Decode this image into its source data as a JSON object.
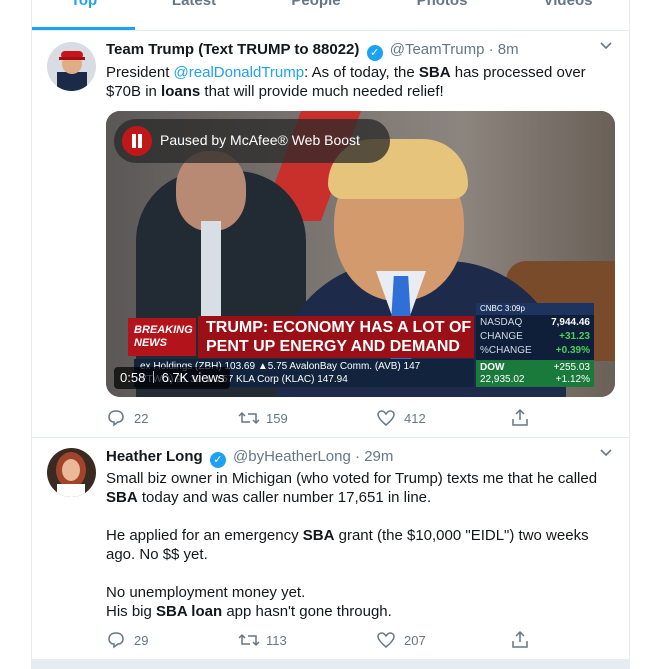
{
  "tabs": [
    {
      "label": "Top",
      "active": true
    },
    {
      "label": "Latest",
      "active": false
    },
    {
      "label": "People",
      "active": false
    },
    {
      "label": "Photos",
      "active": false
    },
    {
      "label": "Videos",
      "active": false
    }
  ],
  "tweets": [
    {
      "display_name": "Team Trump (Text TRUMP to 88022)",
      "handle": "@TeamTrump",
      "separator": "·",
      "time": "8m",
      "text_parts": {
        "p1": "President ",
        "mention": "@realDonaldTrump",
        "p2": ": As of today, the ",
        "b1": "SBA",
        "p3": " has processed over $70B in ",
        "b2": "loans",
        "p4": " that will provide much needed relief!"
      },
      "video": {
        "paused_label": "Paused by McAfee® Web Boost",
        "duration": "0:58",
        "views": "6.7K views",
        "breaking": "BREAKING NEWS",
        "headline": "TRUMP: ECONOMY HAS A LOT OF PENT UP ENERGY AND DEMAND",
        "ticker_line1": "ex Holdings (ZBH) 103.69 ▲5.75   AvalonBay Comm. (AVB) 147",
        "ticker_line2": "VTWO) 91.32 ▲0.57   KLA Corp (KLAC) 147.94",
        "stats": {
          "header": "CNBC   3:09p",
          "nasdaq_label": "NASDAQ",
          "nasdaq_value": "7,944.46",
          "change_label": "CHANGE",
          "change_value": "+31.23",
          "pct_label": "%CHANGE",
          "pct_value": "+0.39%",
          "dow_label": "DOW",
          "dow_value": "22,935.02",
          "dow_change": "+255.03",
          "dow_pct": "+1.12%"
        }
      },
      "replies": "22",
      "retweets": "159",
      "likes": "412"
    },
    {
      "display_name": "Heather Long",
      "handle": "@byHeatherLong",
      "separator": "·",
      "time": "29m",
      "text_parts": {
        "a1": "Small biz owner in Michigan (who voted for Trump) texts me that he called ",
        "a_b": "SBA",
        "a2": " today and was caller number 17,651 in line.",
        "b1": "He applied for an emergency ",
        "b_b": "SBA",
        "b2": " grant (the $10,000 \"EIDL\") two weeks ago. No $$ yet.",
        "c1": "No unemployment money yet.",
        "d1": "His big ",
        "d_b": "SBA loan",
        "d2": " app hasn't gone through."
      },
      "replies": "29",
      "retweets": "113",
      "likes": "207"
    }
  ],
  "colors": {
    "accent": "#1da1f2",
    "muted": "#657786",
    "border": "#e6ecf0"
  }
}
